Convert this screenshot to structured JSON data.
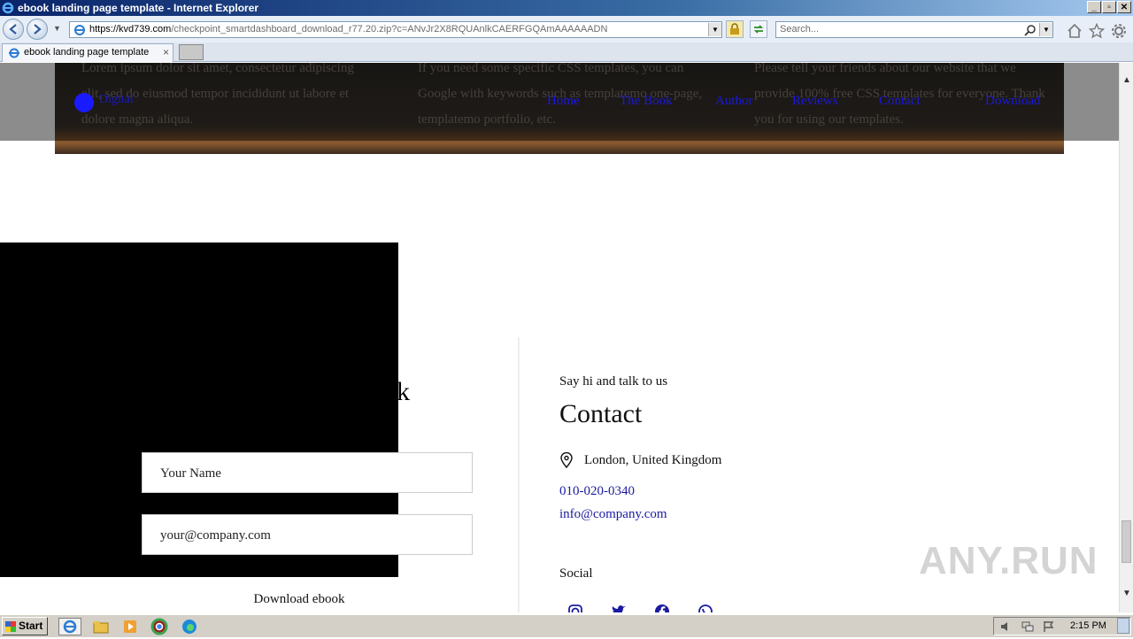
{
  "window": {
    "title": "ebook landing page template - Internet Explorer"
  },
  "address_bar": {
    "host": "https://kvd739.com",
    "path": "/checkpoint_smartdashboard_download_r77.20.zip?c=ANvJr2X8RQUAnlkCAERFGQAmAAAAAADN",
    "search_placeholder": "Search..."
  },
  "tab": {
    "label": "ebook landing page template",
    "close": "×"
  },
  "page": {
    "cards": [
      {
        "text": "Lorem ipsum dolor sit amet, consectetur adipiscing elit, sed do eiusmod tempor incididunt ut labore et dolore magna aliqua."
      },
      {
        "text": "If you need some specific CSS templates, you can Google with keywords such as templatemo one-page, templatemo portfolio, etc."
      },
      {
        "text": "Please tell your friends about our website that we provide 100% free CSS templates for everyone. Thank you for using our templates."
      }
    ],
    "nav": {
      "logo_text": "Digital",
      "links": [
        "Home",
        "The Book",
        "Author",
        "Reviews",
        "Contact",
        "Download"
      ]
    },
    "download_form": {
      "title_fragment": "ok",
      "name_placeholder": "Your Name",
      "email_placeholder": "your@company.com",
      "button_label": "Download ebook"
    },
    "contact": {
      "say_hi": "Say hi and talk to us",
      "title": "Contact",
      "address": "London, United Kingdom",
      "phone": "010-020-0340",
      "email": "info@company.com",
      "social_label": "Social"
    },
    "watermark": "ANY.RUN"
  },
  "taskbar": {
    "start_label": "Start",
    "clock": "2:15 PM"
  }
}
